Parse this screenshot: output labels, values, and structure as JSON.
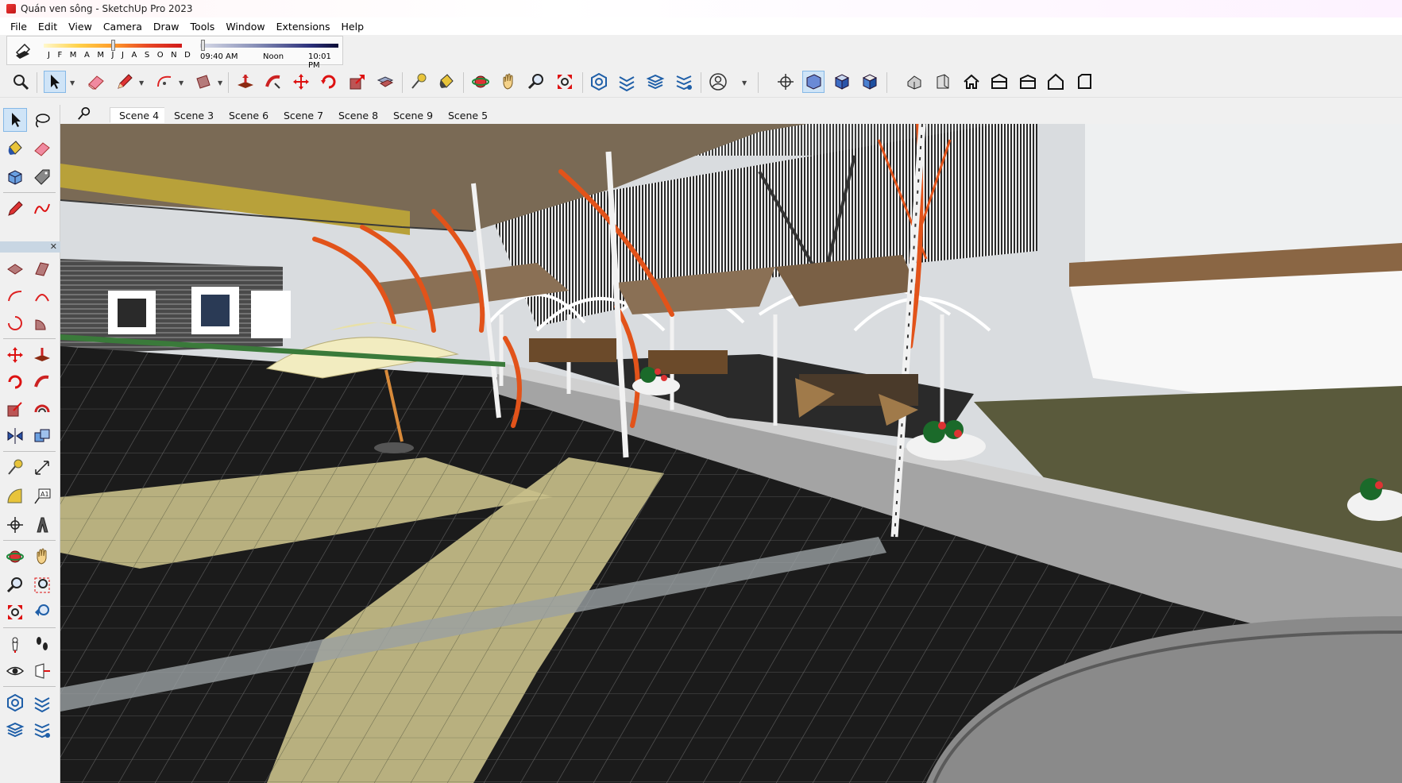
{
  "window": {
    "title": "Quán ven sông - SketchUp Pro 2023"
  },
  "menu": [
    {
      "label": "File"
    },
    {
      "label": "Edit"
    },
    {
      "label": "View"
    },
    {
      "label": "Camera"
    },
    {
      "label": "Draw"
    },
    {
      "label": "Tools"
    },
    {
      "label": "Window"
    },
    {
      "label": "Extensions"
    },
    {
      "label": "Help"
    }
  ],
  "shadows": {
    "months": [
      "J",
      "F",
      "M",
      "A",
      "M",
      "J",
      "J",
      "A",
      "S",
      "O",
      "N",
      "D"
    ],
    "month_position": 0.5,
    "time_start": "09:40 AM",
    "time_mid": "Noon",
    "time_end": "10:01 PM",
    "time_position": 0.02
  },
  "scenes": {
    "tabs": [
      "Scene 4",
      "Scene 3",
      "Scene 6",
      "Scene 7",
      "Scene 8",
      "Scene 9",
      "Scene 5"
    ],
    "active": "Scene 4"
  },
  "colors": {
    "selection_highlight": "#cfe4f7",
    "steel_orange": "#e2531a",
    "umbrella_canvas": "#f2ecc0",
    "floor_tile_dark": "#1e1e1e",
    "floor_tile_light": "#c8c08a",
    "grass": "#5a5a3c",
    "canopy_brown": "#7a6a55"
  },
  "left_toolbar_label": "A1"
}
